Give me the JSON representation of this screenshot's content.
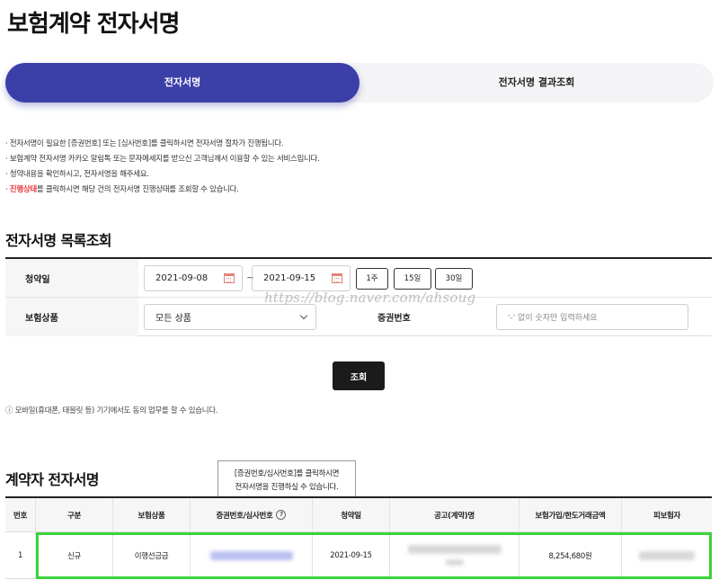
{
  "page": {
    "title": "보험계약 전자서명"
  },
  "tabs": [
    {
      "label": "전자서명",
      "active": true
    },
    {
      "label": "전자서명 결과조회",
      "active": false
    }
  ],
  "notices": [
    "전자서명이 필요한 [증권번호] 또는 [심사번호]를 클릭하시면 전자서명 절차가 진행됩니다.",
    "보험계약 전자서명 카카오 알림톡 또는 문자메세지를 받으신 고객님께서 이용할 수 있는 서비스입니다.",
    "청약내용을 확인하시고, 전자서명을 해주세요.",
    {
      "highlight": "진행상태",
      "rest": "를 클릭하시면 해당 건의 전자서명 진행상태를 조회할 수 있습니다."
    }
  ],
  "search": {
    "section_title": "전자서명 목록조회",
    "date_label": "청약일",
    "start_date": "2021-09-08",
    "tilde": "~",
    "end_date": "2021-09-15",
    "period_buttons": [
      "1주",
      "15일",
      "30일"
    ],
    "product_label": "보험상품",
    "product_selected": "모든 상품",
    "policy_label": "증권번호",
    "policy_placeholder": "'-' 없이 숫자만 입력하세요",
    "watermark": "https://blog.naver.com/ahsoug",
    "button_label": "조회"
  },
  "mobile_note": "모바일(휴대폰, 태블릿 등) 기기에서도 동의 업무를 할 수 있습니다.",
  "results": {
    "section_title": "계약자 전자서명",
    "tooltip": [
      "[증권번호/심사번호]를 클릭하시면",
      "전자서명을 진행하실 수 있습니다."
    ],
    "columns": [
      "번호",
      "구분",
      "보험상품",
      "증권번호/심사번호",
      "청약일",
      "공고(계약)명",
      "보험가입/한도거래금액",
      "피보험자"
    ],
    "rows": [
      {
        "no": "1",
        "type": "신규",
        "product": "이행선금급",
        "date": "2021-09-15",
        "amount": "8,254,680원"
      }
    ]
  },
  "colors": {
    "accent": "#3b3fa8",
    "highlight": "#3bd33b",
    "notice_red": "#e8393a"
  }
}
